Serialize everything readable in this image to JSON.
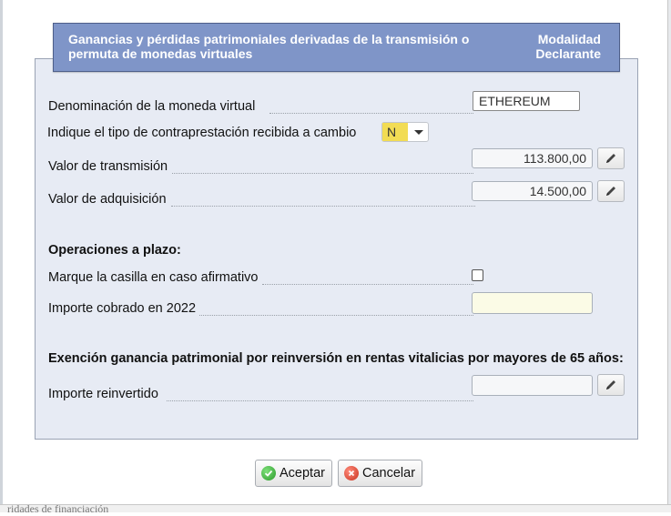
{
  "header": {
    "title": "Ganancias y pérdidas patrimoniales derivadas de la transmisión o permuta de monedas virtuales",
    "right_line1": "Modalidad",
    "right_line2": "Declarante"
  },
  "fields": {
    "currency": {
      "label": "Denominación de la moneda virtual",
      "value": "ETHEREUM"
    },
    "consideration": {
      "label": "Indique el tipo de contraprestación recibida a cambio",
      "value": "N"
    },
    "transmission": {
      "label": "Valor de transmisión",
      "value": "113.800,00"
    },
    "acquisition": {
      "label": "Valor de adquisición",
      "value": "14.500,00"
    }
  },
  "installments": {
    "heading": "Operaciones a plazo:",
    "checkbox_label": "Marque la casilla en caso afirmativo",
    "checked": false,
    "collected_label": "Importe cobrado en 2022",
    "collected_value": ""
  },
  "exemption": {
    "heading": "Exención ganancia patrimonial por reinversión en rentas vitalicias por mayores de 65 años:",
    "reinvested_label": "Importe reinvertido",
    "reinvested_value": ""
  },
  "buttons": {
    "accept": "Aceptar",
    "cancel": "Cancelar"
  },
  "icons": {
    "edit": "pencil-icon",
    "accept": "check-circle-icon",
    "cancel": "x-circle-icon",
    "dropdown": "chevron-down-icon"
  },
  "colors": {
    "header_bg": "#7f95c8",
    "panel_bg": "#e7ebf4",
    "select_highlight": "#f2dc54",
    "field_yellow": "#fbfbe6"
  },
  "background": {
    "bottom_text": "ridades de financiación"
  }
}
